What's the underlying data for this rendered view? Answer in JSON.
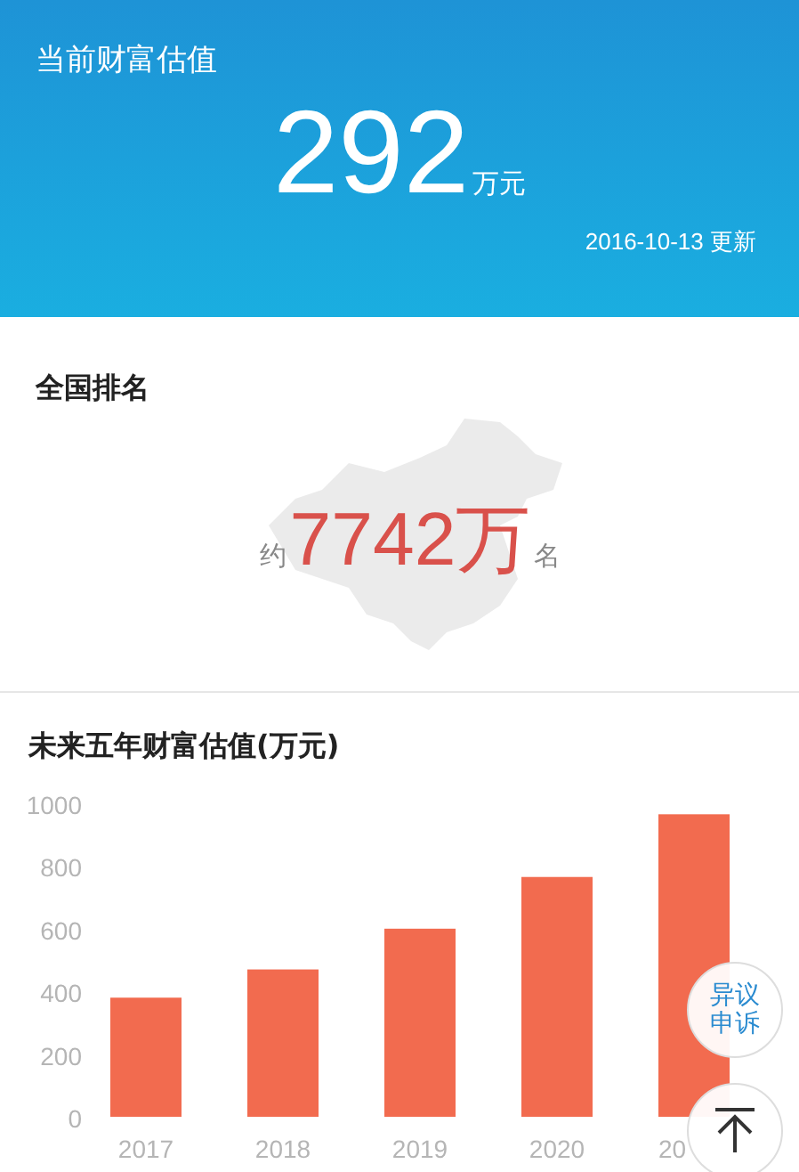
{
  "header": {
    "title": "当前财富估值",
    "value": "292",
    "unit": "万元",
    "updated": "2016-10-13 更新"
  },
  "ranking": {
    "title": "全国排名",
    "prefix": "约",
    "value": "7742万",
    "suffix": "名"
  },
  "forecast": {
    "chart_data": {
      "type": "bar",
      "title": "未来五年财富估值(万元)",
      "categories": [
        "2017",
        "2018",
        "2019",
        "2020",
        "20"
      ],
      "series": [
        {
          "color": "#f26b4f",
          "values": [
            380,
            470,
            600,
            765,
            965
          ]
        }
      ],
      "ylim": [
        0,
        1000
      ],
      "yticks": [
        0,
        200,
        400,
        600,
        800,
        1000
      ]
    }
  },
  "appeal_button": {
    "label": "异议申诉"
  }
}
